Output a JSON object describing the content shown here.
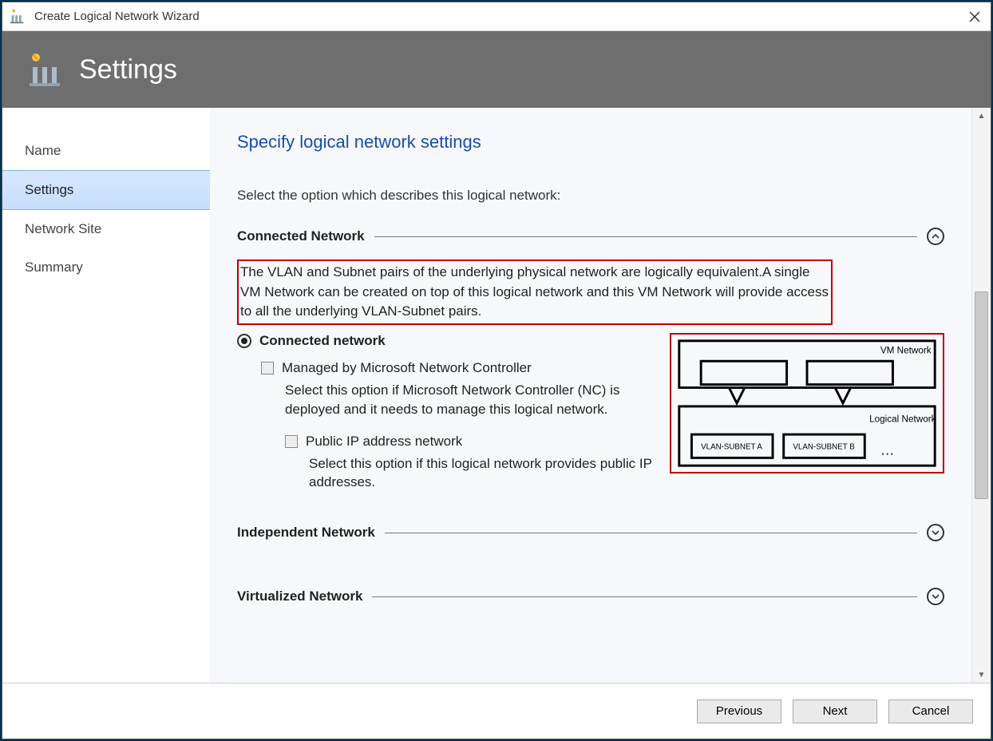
{
  "window": {
    "title": "Create Logical Network Wizard"
  },
  "header": {
    "title": "Settings"
  },
  "sidebar": {
    "items": [
      {
        "label": "Name",
        "selected": false
      },
      {
        "label": "Settings",
        "selected": true
      },
      {
        "label": "Network Site",
        "selected": false
      },
      {
        "label": "Summary",
        "selected": false
      }
    ]
  },
  "content": {
    "page_title": "Specify logical network settings",
    "intro": "Select the option which describes this logical network:",
    "sections": {
      "connected": {
        "title": "Connected Network",
        "expanded": true,
        "description": "The VLAN and Subnet pairs of the underlying physical network are logically equivalent.A single VM Network can be created on top of this logical network and this VM Network will provide access to all the underlying VLAN-Subnet pairs.",
        "radio_label": "Connected network",
        "radio_selected": true,
        "check1_label": "Managed by Microsoft Network Controller",
        "check1_desc": "Select this option if Microsoft Network Controller (NC) is deployed and it needs to manage this logical network.",
        "check2_label": "Public IP address network",
        "check2_desc": "Select this option if this logical network provides public IP addresses.",
        "diagram": {
          "vm_network": "VM Network",
          "logical_network": "Logical Network",
          "sub_a": "VLAN-SUBNET A",
          "sub_b": "VLAN-SUBNET B",
          "ellipsis": "…"
        }
      },
      "independent": {
        "title": "Independent Network",
        "expanded": false
      },
      "virtualized": {
        "title": "Virtualized Network",
        "expanded": false
      }
    }
  },
  "footer": {
    "previous": "Previous",
    "next": "Next",
    "cancel": "Cancel"
  }
}
